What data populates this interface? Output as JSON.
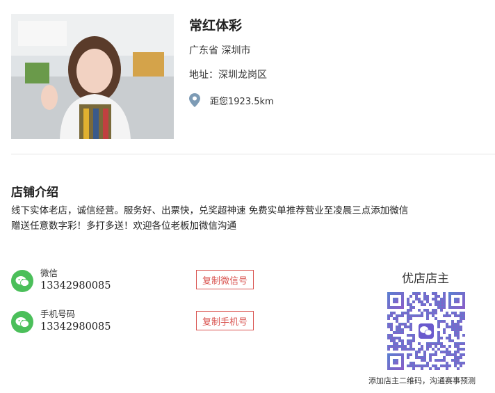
{
  "shop": {
    "name": "常红体彩",
    "region": "广东省 深圳市",
    "address": "地址：深圳龙岗区",
    "distance": "距您1923.5km"
  },
  "intro": {
    "title": "店铺介绍",
    "line1": "线下实体老店，诚信经营。服务好、出票快，兑奖超神速 免费实单推荐营业至凌晨三点添加微信",
    "line2": "赠送任意数字彩！多打多送！欢迎各位老板加微信沟通"
  },
  "contacts": [
    {
      "label": "微信",
      "value": "13342980085",
      "button": "复制微信号"
    },
    {
      "label": "手机号码",
      "value": "13342980085",
      "button": "复制手机号"
    }
  ],
  "owner": {
    "title": "优店店主",
    "caption": "添加店主二维码，沟通赛事预测"
  },
  "colors": {
    "accent_red": "#d9534f",
    "wechat_green": "#4bbf5a",
    "qr_purple": "#6a5acd"
  }
}
